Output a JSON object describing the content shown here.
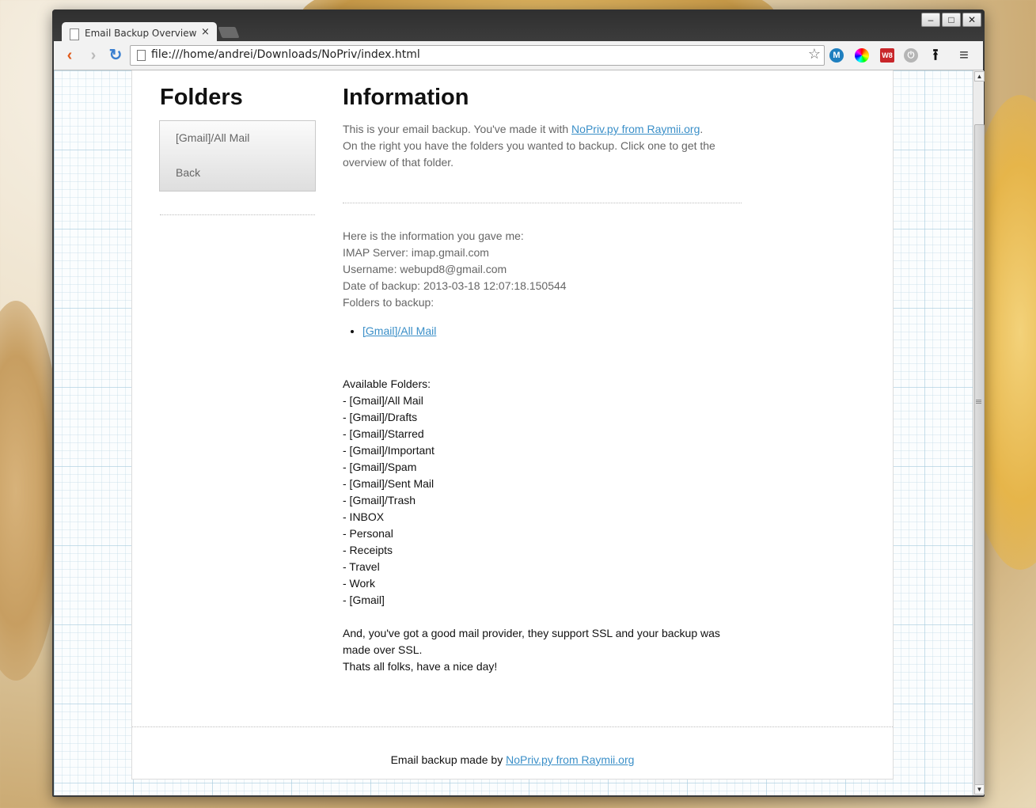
{
  "browser": {
    "tab_title": "Email Backup Overview P",
    "tab_close": "×",
    "url": "file:///home/andrei/Downloads/NoPriv/index.html",
    "extensions": [
      {
        "label": "M",
        "color": "#1f7fbf"
      },
      {
        "label": "",
        "color": "conic"
      },
      {
        "label": "W8",
        "color": "#c8262a"
      },
      {
        "label": "",
        "color": "#999999"
      }
    ]
  },
  "sidebar": {
    "title": "Folders",
    "items": [
      {
        "label": "[Gmail]/All Mail"
      },
      {
        "label": "Back"
      }
    ]
  },
  "main": {
    "title": "Information",
    "intro_before_link": "This is your email backup. You've made it with ",
    "intro_link": "NoPriv.py from Raymii.org",
    "intro_after_link": ".",
    "intro_line2": "On the right you have the folders you wanted to backup. Click one to get the overview of that folder.",
    "info_heading": "Here is the information you gave me:",
    "imap_server": "IMAP Server: imap.gmail.com",
    "username": "Username: webupd8@gmail.com",
    "date_of_backup": "Date of backup: 2013-03-18 12:07:18.150544",
    "folders_to_backup_label": "Folders to backup:",
    "folders_to_backup": [
      "[Gmail]/All Mail"
    ],
    "available_label": "Available Folders:",
    "available_folders": [
      "- [Gmail]/All Mail",
      "- [Gmail]/Drafts",
      "- [Gmail]/Starred",
      "- [Gmail]/Important",
      "- [Gmail]/Spam",
      "- [Gmail]/Sent Mail",
      "- [Gmail]/Trash",
      "- INBOX",
      "- Personal",
      "- Receipts",
      "- Travel",
      "- Work",
      "- [Gmail]"
    ],
    "ssl_note": "And, you've got a good mail provider, they support SSL and your backup was made over SSL.",
    "signoff": "Thats all folks, have a nice day!"
  },
  "footer": {
    "text_before_link": "Email backup made by ",
    "link": "NoPriv.py from Raymii.org"
  }
}
